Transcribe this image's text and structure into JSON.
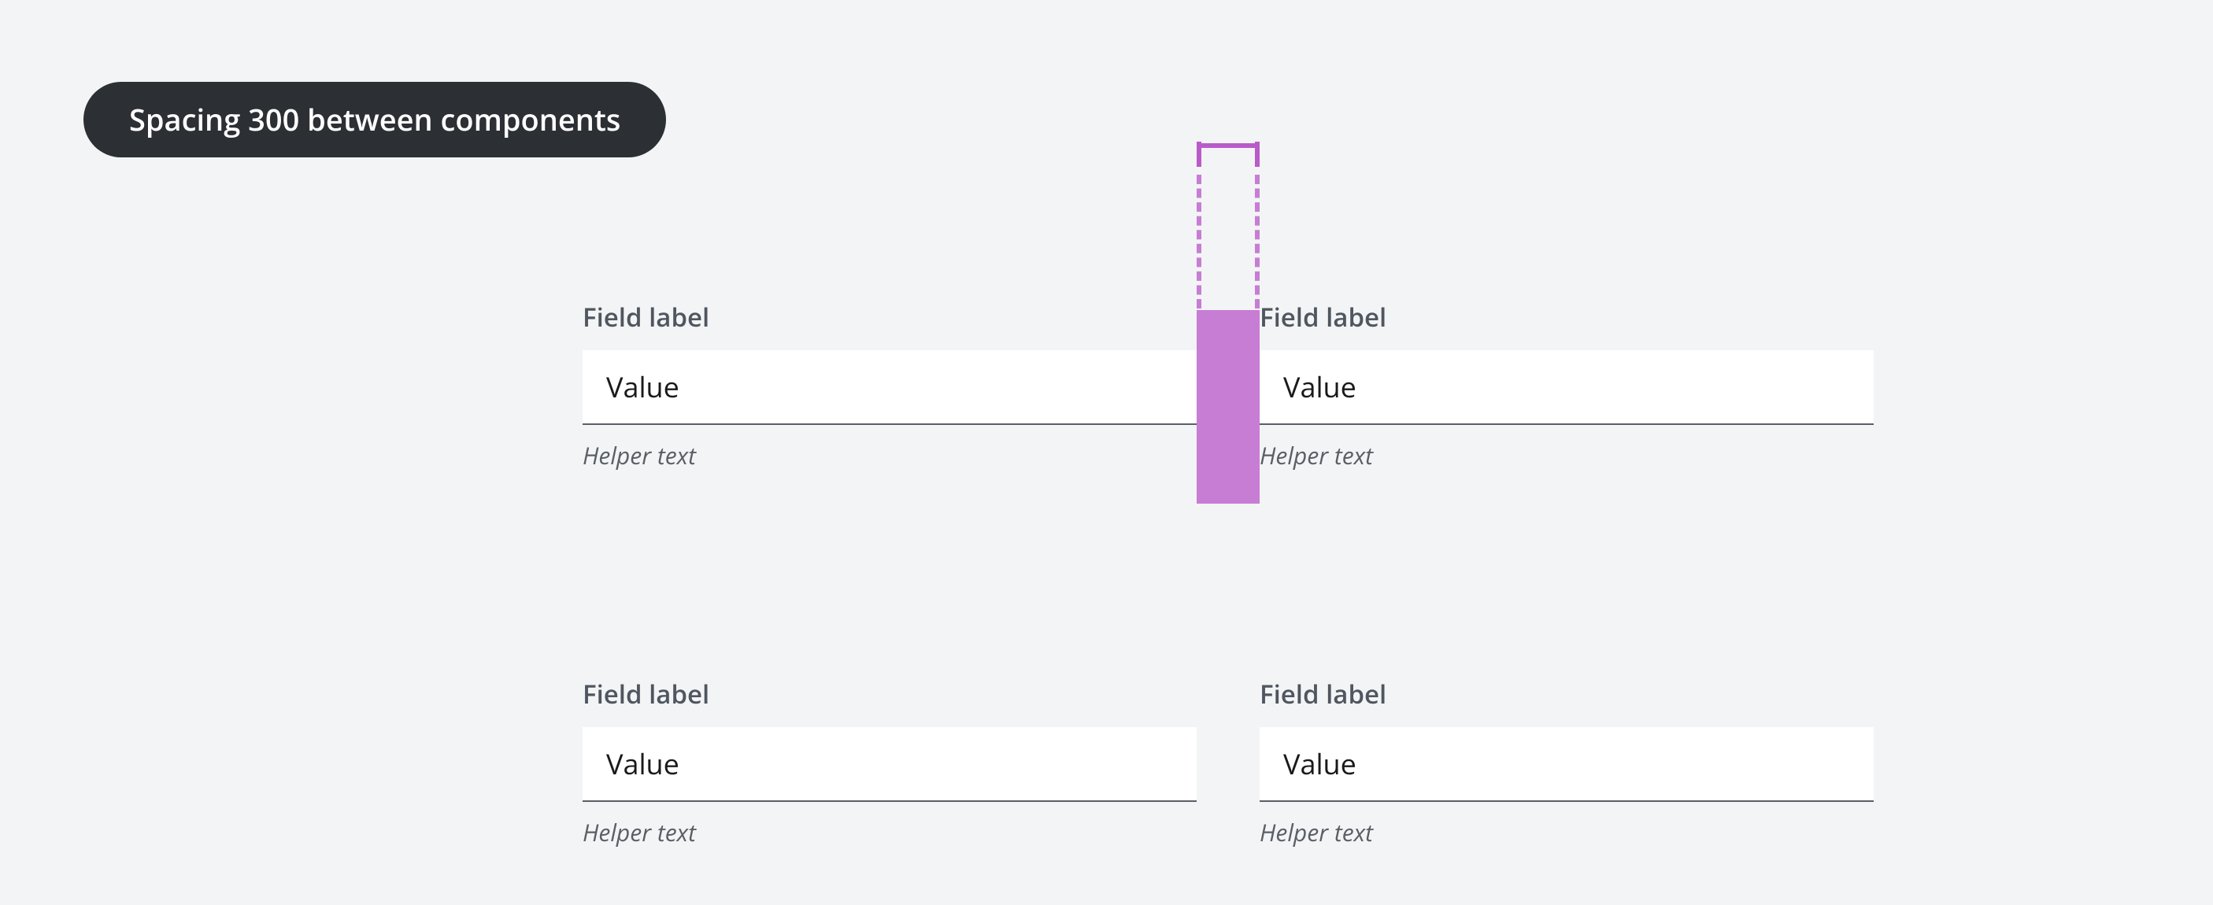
{
  "title": "Spacing 300 between components",
  "colors": {
    "pill_bg": "#2c2f33",
    "pill_text": "#ffffff",
    "page_bg": "#f3f4f5",
    "label": "#4f5660",
    "helper": "#5a5f66",
    "value": "#1a1a1a",
    "indicator": "#c77dd4",
    "indicator_dark": "#b85bc9"
  },
  "spacing_token": "300",
  "rows": [
    {
      "left": {
        "label": "Field label",
        "value": "Value",
        "helper": "Helper text"
      },
      "right": {
        "label": "Field label",
        "value": "Value",
        "helper": "Helper text"
      }
    },
    {
      "left": {
        "label": "Field label",
        "value": "Value",
        "helper": "Helper text"
      },
      "right": {
        "label": "Field label",
        "value": "Value",
        "helper": "Helper text"
      }
    }
  ]
}
